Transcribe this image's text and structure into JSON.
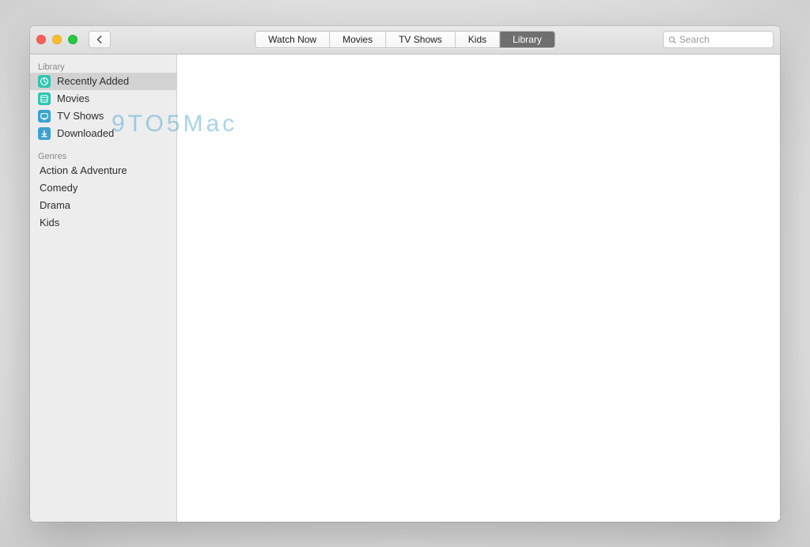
{
  "toolbar": {
    "tabs": [
      "Watch Now",
      "Movies",
      "TV Shows",
      "Kids",
      "Library"
    ],
    "active_tab_index": 4,
    "search_placeholder": "Search"
  },
  "sidebar": {
    "sections": [
      {
        "title": "Library",
        "items": [
          {
            "label": "Recently Added",
            "icon": "clock-icon",
            "icon_color": "#2fc6b2",
            "selected": true
          },
          {
            "label": "Movies",
            "icon": "film-icon",
            "icon_color": "#2fc6b2",
            "selected": false
          },
          {
            "label": "TV Shows",
            "icon": "tv-icon",
            "icon_color": "#3aa2d0",
            "selected": false
          },
          {
            "label": "Downloaded",
            "icon": "download-icon",
            "icon_color": "#3aa2d0",
            "selected": false
          }
        ]
      },
      {
        "title": "Genres",
        "items": [
          {
            "label": "Action & Adventure"
          },
          {
            "label": "Comedy"
          },
          {
            "label": "Drama"
          },
          {
            "label": "Kids"
          }
        ]
      }
    ]
  },
  "watermark": "9TO5Mac"
}
